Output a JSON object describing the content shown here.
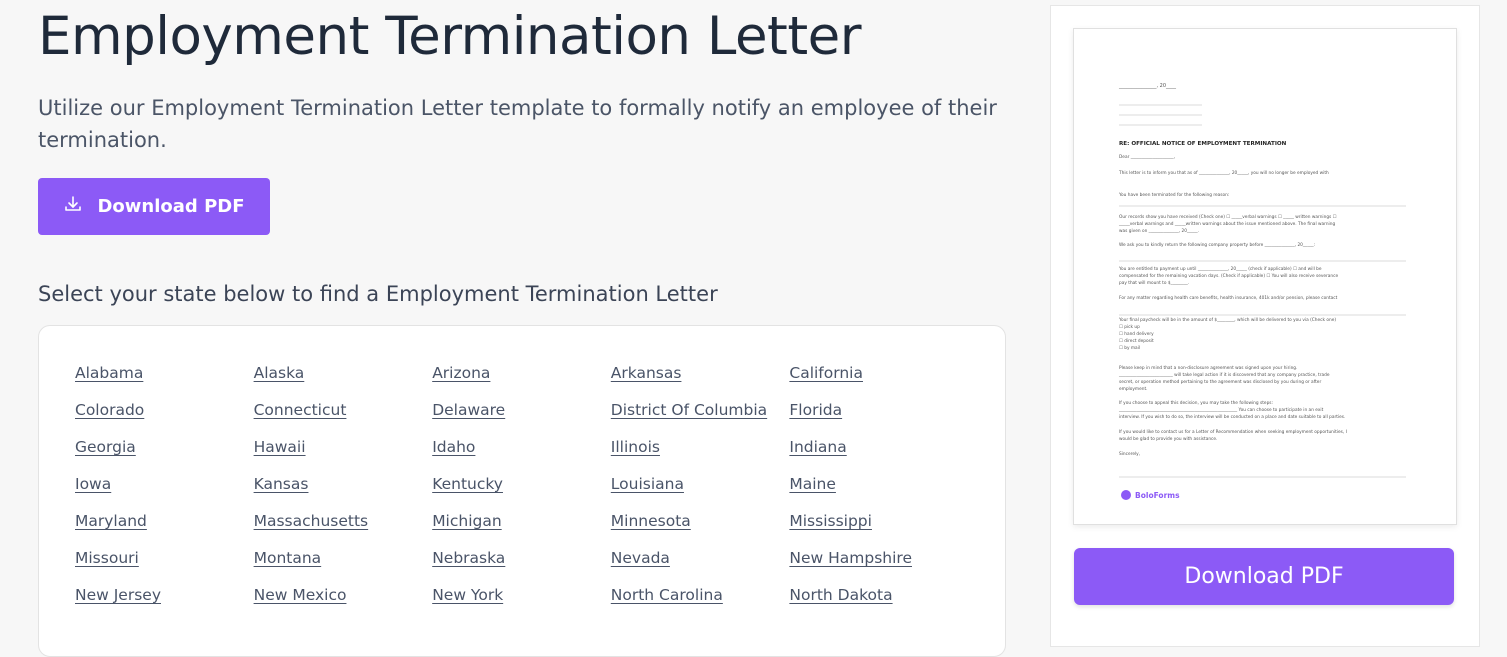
{
  "header": {
    "title": "Employment Termination Letter",
    "subtitle": "Utilize our Employment Termination Letter template to formally notify an employee of their termination."
  },
  "primary_button": {
    "label": "Download PDF",
    "icon": "download-icon"
  },
  "states_section": {
    "heading": "Select your state below to find a Employment Termination Letter",
    "states": [
      "Alabama",
      "Alaska",
      "Arizona",
      "Arkansas",
      "California",
      "Colorado",
      "Connecticut",
      "Delaware",
      "District Of Columbia",
      "Florida",
      "Georgia",
      "Hawaii",
      "Idaho",
      "Illinois",
      "Indiana",
      "Iowa",
      "Kansas",
      "Kentucky",
      "Louisiana",
      "Maine",
      "Maryland",
      "Massachusetts",
      "Michigan",
      "Minnesota",
      "Mississippi",
      "Missouri",
      "Montana",
      "Nebraska",
      "Nevada",
      "New Hampshire",
      "New Jersey",
      "New Mexico",
      "New York",
      "North Carolina",
      "North Dakota"
    ]
  },
  "preview": {
    "heading": "RE: OFFICIAL NOTICE OF EMPLOYMENT TERMINATION",
    "date_line": "_______________, 20____",
    "brand": "BoloForms",
    "lines": [
      "Dear ____________________,",
      "This letter is to inform you that as of ______________, 20_____, you will no longer be employed with",
      "You have been terminated for the following reason:",
      "Our records show you have received (Check one) ☐ _____verbal warnings ☐ _____ written warnings ☐",
      "_____verbal warnings and _____written warnings about the issue mentioned above. The final warning",
      "was given on ______________, 20_____.",
      "We ask you to kindly return the following company property before ______________, 20_____:",
      "You are entitled to payment up until ______________, 20_____ (check if applicable) ☐ and will be",
      "compensated for the remaining vacation days. (Check if applicable) ☐ You will also receive severance",
      "pay that will mount to $________.",
      "For any matter regarding health care benefits, health insurance, 401k and/or pension, please contact",
      "Your final paycheck will be in the amount of $________, which will be delivered to you via (Check one)",
      "☐ pick up",
      "☐ hand delivery",
      "☐ direct deposit",
      "☐ by mail",
      "Please keep in mind that a non-disclosure agreement was signed upon your hiring.",
      "_________________________ will take legal action if it is discovered that any company practice, trade",
      "secret, or operation method pertaining to the agreement was disclosed by you during or after",
      "employment.",
      "If you choose to appeal this decision, you may take the following steps:",
      "_______________________________________________________ You can choose to participate in an exit",
      "interview. If you wish to do so, the interview will be conducted on a place and date suitable to all parties.",
      "If you would like to contact us for a Letter of Recommendation when seeking employment opportunities, I",
      "would be glad to provide you with assistance.",
      "Sincerely,"
    ]
  },
  "secondary_button": {
    "label": "Download PDF"
  },
  "colors": {
    "accent": "#8c5af6",
    "text": "#1f2a3a",
    "link": "#4a5468"
  }
}
